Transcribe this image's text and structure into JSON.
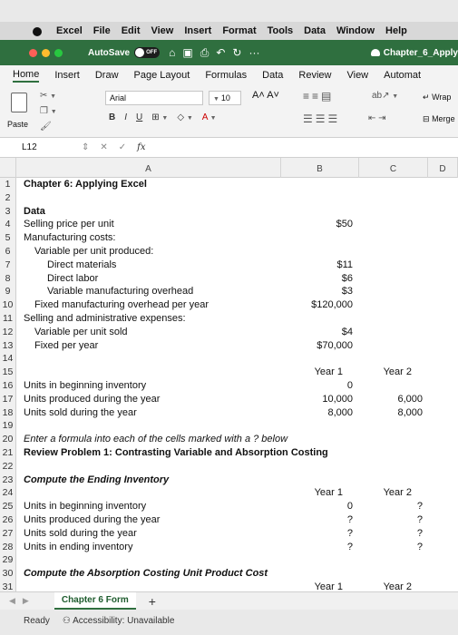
{
  "menubar": {
    "app": "Excel",
    "items": [
      "File",
      "Edit",
      "View",
      "Insert",
      "Format",
      "Tools",
      "Data",
      "Window",
      "Help"
    ]
  },
  "titlebar": {
    "autosave_label": "AutoSave",
    "autosave_state": "OFF",
    "more": "···",
    "doc_title": "Chapter_6_Apply"
  },
  "ribbon_tabs": [
    "Home",
    "Insert",
    "Draw",
    "Page Layout",
    "Formulas",
    "Data",
    "Review",
    "View",
    "Automat"
  ],
  "ribbon": {
    "paste_label": "Paste",
    "font_name": "Arial",
    "font_size": "10",
    "grow_shrink": "A˄ A˅",
    "bold": "B",
    "italic": "I",
    "underline": "U",
    "wrap_label": "Wrap",
    "merge_label": "Merge"
  },
  "formula_bar": {
    "name_box": "L12",
    "fx": "fx",
    "content": ""
  },
  "columns": [
    "A",
    "B",
    "C",
    "D"
  ],
  "rows": [
    {
      "n": "1",
      "a": "Chapter 6: Applying Excel",
      "b": "",
      "c": "",
      "a_style": "bold"
    },
    {
      "n": "2",
      "a": "",
      "b": "",
      "c": ""
    },
    {
      "n": "3",
      "a": "Data",
      "b": "",
      "c": "",
      "a_style": "bold"
    },
    {
      "n": "4",
      "a": "Selling price per unit",
      "b": "$50",
      "c": ""
    },
    {
      "n": "5",
      "a": "Manufacturing costs:",
      "b": "",
      "c": ""
    },
    {
      "n": "6",
      "a": "Variable per unit produced:",
      "b": "",
      "c": "",
      "a_indent": 1
    },
    {
      "n": "7",
      "a": "Direct materials",
      "b": "$11",
      "c": "",
      "a_indent": 2
    },
    {
      "n": "8",
      "a": "Direct labor",
      "b": "$6",
      "c": "",
      "a_indent": 2
    },
    {
      "n": "9",
      "a": "Variable manufacturing overhead",
      "b": "$3",
      "c": "",
      "a_indent": 2
    },
    {
      "n": "10",
      "a": "Fixed manufacturing overhead per year",
      "b": "$120,000",
      "c": "",
      "a_indent": 1
    },
    {
      "n": "11",
      "a": "Selling and administrative expenses:",
      "b": "",
      "c": ""
    },
    {
      "n": "12",
      "a": "Variable per unit sold",
      "b": "$4",
      "c": "",
      "a_indent": 1
    },
    {
      "n": "13",
      "a": "Fixed per year",
      "b": "$70,000",
      "c": "",
      "a_indent": 1
    },
    {
      "n": "14",
      "a": "",
      "b": "",
      "c": ""
    },
    {
      "n": "15",
      "a": "",
      "b": "Year 1",
      "c": "Year 2",
      "bc_center": true
    },
    {
      "n": "16",
      "a": "Units in beginning inventory",
      "b": "0",
      "c": ""
    },
    {
      "n": "17",
      "a": "Units produced during the year",
      "b": "10,000",
      "c": "6,000"
    },
    {
      "n": "18",
      "a": "Units sold during the year",
      "b": "8,000",
      "c": "8,000"
    },
    {
      "n": "19",
      "a": "",
      "b": "",
      "c": ""
    },
    {
      "n": "20",
      "a": "Enter a formula into each of the cells marked with a ? below",
      "b": "",
      "c": "",
      "a_style": "ital"
    },
    {
      "n": "21",
      "a": "Review Problem 1: Contrasting Variable and Absorption Costing",
      "b": "",
      "c": "",
      "a_style": "bold"
    },
    {
      "n": "22",
      "a": "",
      "b": "",
      "c": ""
    },
    {
      "n": "23",
      "a": "Compute the Ending Inventory",
      "b": "",
      "c": "",
      "a_style": "bi"
    },
    {
      "n": "24",
      "a": "",
      "b": "Year 1",
      "c": "Year 2",
      "bc_center": true
    },
    {
      "n": "25",
      "a": "Units in beginning inventory",
      "b": "0",
      "c": "?"
    },
    {
      "n": "26",
      "a": "Units produced during the year",
      "b": "?",
      "c": "?"
    },
    {
      "n": "27",
      "a": "Units sold during the year",
      "b": "?",
      "c": "?"
    },
    {
      "n": "28",
      "a": "Units in ending inventory",
      "b": "?",
      "c": "?"
    },
    {
      "n": "29",
      "a": "",
      "b": "",
      "c": ""
    },
    {
      "n": "30",
      "a": "Compute the Absorption Costing Unit Product Cost",
      "b": "",
      "c": "",
      "a_style": "bi"
    },
    {
      "n": "31",
      "a": "",
      "b": "Year 1",
      "c": "Year 2",
      "bc_center": true
    }
  ],
  "sheet_tabs": {
    "active": "Chapter 6 Form",
    "add": "+"
  },
  "status_bar": {
    "ready": "Ready",
    "accessibility": "Accessibility: Unavailable"
  }
}
